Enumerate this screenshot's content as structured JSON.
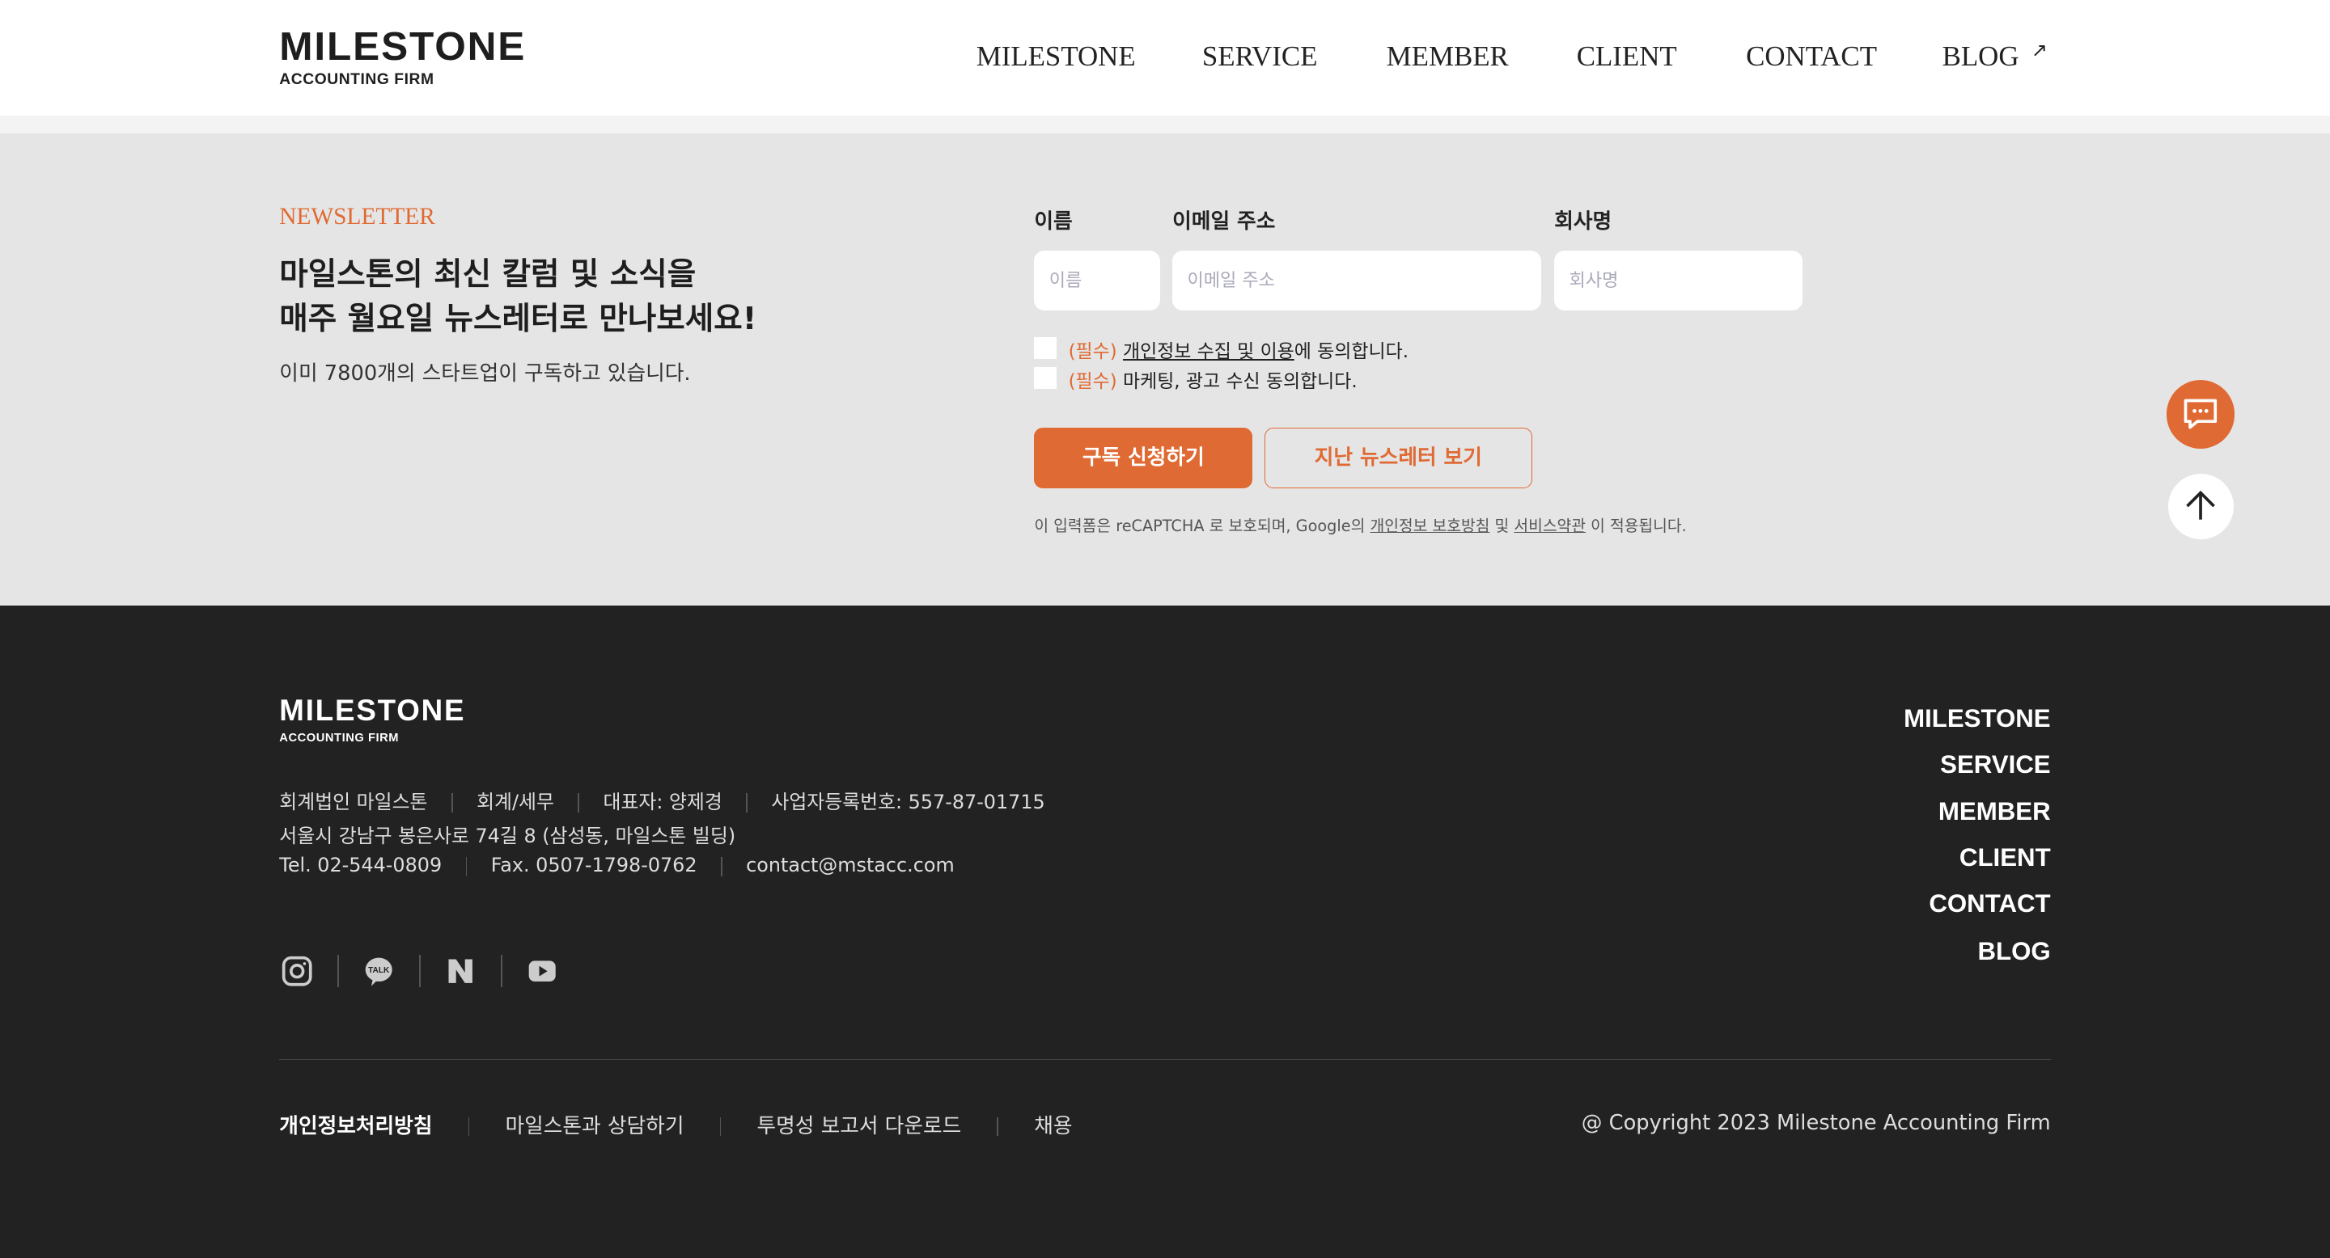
{
  "header": {
    "logo_main": "MILESTONE",
    "logo_sub": "ACCOUNTING FIRM",
    "nav": [
      "MILESTONE",
      "SERVICE",
      "MEMBER",
      "CLIENT",
      "CONTACT",
      "BLOG"
    ]
  },
  "newsletter": {
    "eyebrow": "NEWSLETTER",
    "title_line1": "마일스톤의 최신 칼럼 및 소식을",
    "title_line2": "매주 월요일 뉴스레터로 만나보세요!",
    "subtitle": "이미 7800개의 스타트업이 구독하고 있습니다.",
    "fields": [
      {
        "label": "이름",
        "placeholder": "이름"
      },
      {
        "label": "이메일 주소",
        "placeholder": "이메일 주소"
      },
      {
        "label": "회사명",
        "placeholder": "회사명"
      }
    ],
    "consent1": {
      "req": "(필수)",
      "link": "개인정보 수집 및 이용",
      "rest": "에 동의합니다."
    },
    "consent2": {
      "req": "(필수)",
      "rest": "마케팅, 광고 수신 동의합니다."
    },
    "subscribe": "구독 신청하기",
    "past": "지난 뉴스레터 보기",
    "recaptcha": {
      "pre": "이 입력폼은 reCAPTCHA 로 보호되며, Google의 ",
      "privacy": "개인정보 보호방침",
      "mid": " 및 ",
      "terms": "서비스약관",
      "post": " 이 적용됩니다."
    },
    "accent": "#e06a33"
  },
  "footer": {
    "logo_main": "MILESTONE",
    "logo_sub": "ACCOUNTING FIRM",
    "info1": [
      "회계법인 마일스톤",
      "회계/세무",
      "대표자: 양제경",
      "사업자등록번호: 557-87-01715"
    ],
    "address": "서울시 강남구 봉은사로 74길 8 (삼성동, 마일스톤 빌딩)",
    "info3": [
      "Tel. 02-544-0809",
      "Fax. 0507-1798-0762",
      "contact@mstacc.com"
    ],
    "social": [
      "instagram-icon",
      "kakaotalk-icon",
      "naver-icon",
      "youtube-icon"
    ],
    "kakao_text": "TALK",
    "nav": [
      "MILESTONE",
      "SERVICE",
      "MEMBER",
      "CLIENT",
      "CONTACT",
      "BLOG"
    ],
    "links": [
      "개인정보처리방침",
      "마일스톤과 상담하기",
      "투명성 보고서 다운로드",
      "채용"
    ],
    "copyright": "@ Copyright 2023 Milestone Accounting Firm"
  }
}
